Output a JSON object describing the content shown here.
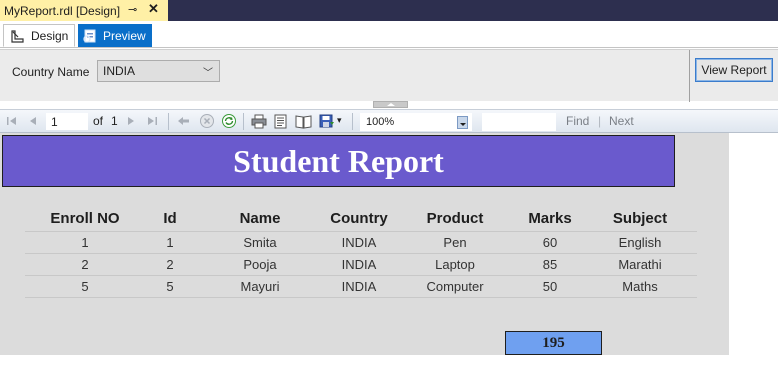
{
  "document_tab": {
    "title": "MyReport.rdl [Design]",
    "pin_icon": "pin-icon",
    "close_icon": "close-icon"
  },
  "view_tabs": [
    {
      "label": "Design",
      "icon": "design-icon",
      "active": false
    },
    {
      "label": "Preview",
      "icon": "preview-icon",
      "active": true
    }
  ],
  "parameters": {
    "label": "Country Name",
    "selected": "INDIA",
    "view_report_label": "View Report"
  },
  "toolbar": {
    "page_current": "1",
    "page_of": "of",
    "page_total": "1",
    "zoom": "100%",
    "find_label": "Find",
    "find_sep": "|",
    "next_label": "Next"
  },
  "report": {
    "title": "Student Report",
    "columns": [
      "Enroll NO",
      "Id",
      "Name",
      "Country",
      "Product",
      "Marks",
      "Subject"
    ],
    "rows": [
      [
        "1",
        "1",
        "Smita",
        "INDIA",
        "Pen",
        "60",
        "English"
      ],
      [
        "2",
        "2",
        "Pooja",
        "INDIA",
        "Laptop",
        "85",
        "Marathi"
      ],
      [
        "5",
        "5",
        "Mayuri",
        "INDIA",
        "Computer",
        "50",
        "Maths"
      ]
    ],
    "total": "195"
  },
  "colors": {
    "title_bg": "#6a5acd",
    "total_bg": "#6fa0f0",
    "tab_active": "#0a6fc9",
    "doc_tab": "#fff0a6"
  }
}
